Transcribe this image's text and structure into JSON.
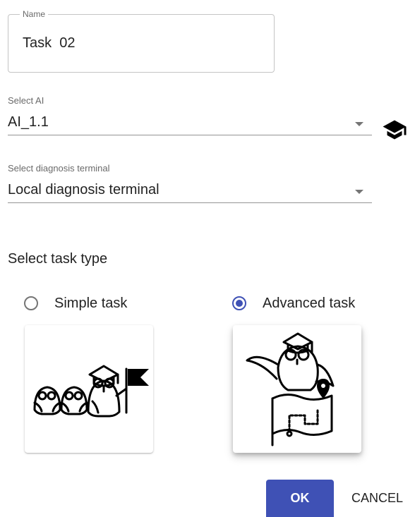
{
  "name_field": {
    "label": "Name",
    "value": "Task  02"
  },
  "ai_select": {
    "label": "Select AI",
    "value": "AI_1.1",
    "icon": "graduation-cap-icon"
  },
  "diagnosis_select": {
    "label": "Select diagnosis terminal",
    "value": "Local diagnosis terminal"
  },
  "task_type": {
    "title": "Select task type",
    "options": [
      {
        "label": "Simple task",
        "selected": false,
        "illustration": "owls-with-flag-illustration"
      },
      {
        "label": "Advanced task",
        "selected": true,
        "illustration": "owl-with-map-illustration"
      }
    ]
  },
  "actions": {
    "ok_label": "OK",
    "cancel_label": "CANCEL"
  },
  "colors": {
    "primary": "#3f51b5",
    "text": "#212121"
  }
}
